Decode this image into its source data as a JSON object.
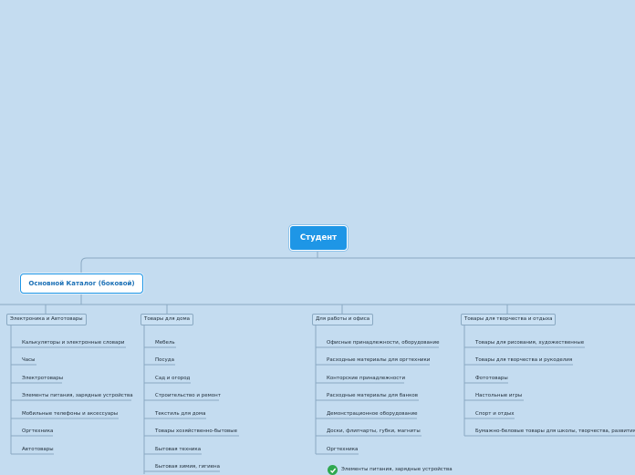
{
  "root": {
    "label": "Студент"
  },
  "main_topic": {
    "label": "Основной Каталог (боковой)"
  },
  "categories": [
    {
      "label": "Электроника и Автотовары",
      "items": [
        "Калькуляторы и электронные словари",
        "Часы",
        "Электротовары",
        "Элементы питания, зарядные устройства",
        "Мобильные телефоны и аксессуары",
        "Оргтехника",
        "Автотовары"
      ]
    },
    {
      "label": "Товары для дома",
      "items": [
        "Мебель",
        "Посуда",
        "Сад и огород",
        "Строительство и ремонт",
        "Текстиль для дома",
        "Товары хозяйственно-бытовые",
        "Бытовая техника",
        "Бытовая химия, гигиена"
      ]
    },
    {
      "label": "Для работы и офиса",
      "items": [
        "Офисные принадлежности, оборудование",
        "Расходные материалы для оргтехники",
        "Конторские принадлежности",
        "Расходные материалы для банков",
        "Демонстрационное оборудование",
        "Доски, флипчарты, губки, магниты",
        "Оргтехника"
      ],
      "marked_item": "Элементы питания, зарядные устройства"
    },
    {
      "label": "Товары для творчества и отдыха",
      "items": [
        "Товары для рисования, художественные",
        "Товары для творчества и рукоделия",
        "Фототовары",
        "Настольные игры",
        "Спорт и отдых",
        "Бумажно-беловые товары для школы, творчества, развития"
      ]
    }
  ],
  "colors": {
    "background": "#c4dcf0",
    "accent": "#1e96e6",
    "line": "#8aa9c2",
    "check": "#2fa84f"
  }
}
